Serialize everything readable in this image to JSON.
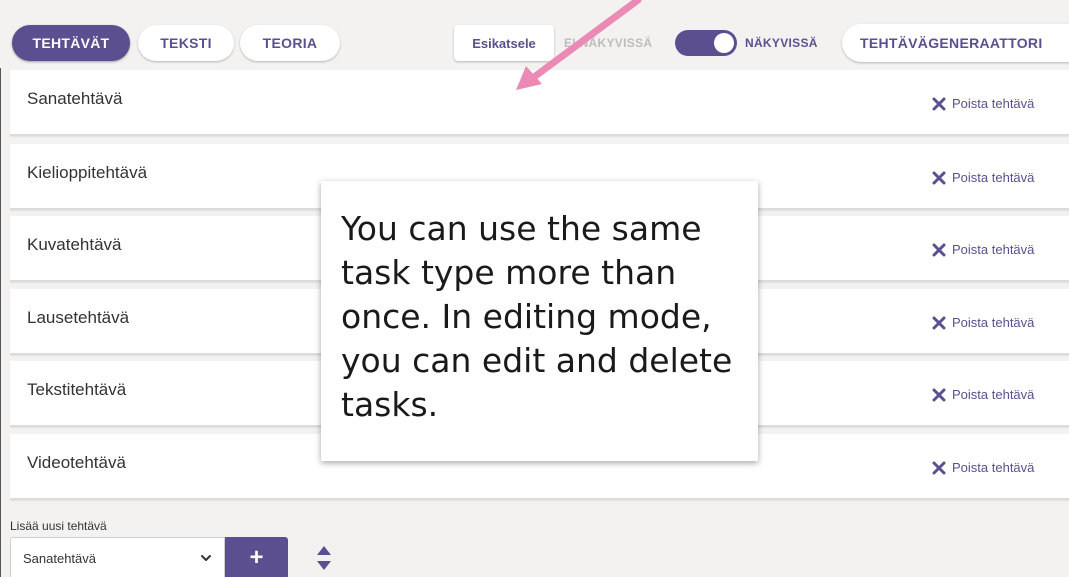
{
  "tabs": [
    {
      "label": "TEHTÄVÄT",
      "active": true
    },
    {
      "label": "TEKSTI",
      "active": false
    },
    {
      "label": "TEORIA",
      "active": false
    }
  ],
  "toolbar": {
    "preview_label": "Esikatsele",
    "toggle_off_label": "EI NÄKYVISSÄ",
    "toggle_on_label": "NÄKYVISSÄ",
    "toggle_state": "on",
    "generator_label": "TEHTÄVÄGENERAATTORI"
  },
  "tasks": [
    {
      "name": "Sanatehtävä",
      "delete_label": "Poista tehtävä"
    },
    {
      "name": "Kielioppitehtävä",
      "delete_label": "Poista tehtävä"
    },
    {
      "name": "Kuvatehtävä",
      "delete_label": "Poista tehtävä"
    },
    {
      "name": "Lausetehtävä",
      "delete_label": "Poista tehtävä"
    },
    {
      "name": "Tekstitehtävä",
      "delete_label": "Poista tehtävä"
    },
    {
      "name": "Videotehtävä",
      "delete_label": "Poista tehtävä"
    }
  ],
  "add_task": {
    "label": "Lisää uusi tehtävä",
    "selected_type": "Sanatehtävä",
    "add_button": "+"
  },
  "callout": {
    "text": "You can use the same task type more than once. In editing mode, you can edit and delete tasks."
  },
  "colors": {
    "accent": "#5b4f8f",
    "arrow": "#ea8ab5",
    "background": "#f3f2f1"
  },
  "icons": {
    "delete": "close-x-icon",
    "select": "chevron-down-icon",
    "sort": "sort-updown-icon",
    "annotation": "arrow-icon"
  }
}
